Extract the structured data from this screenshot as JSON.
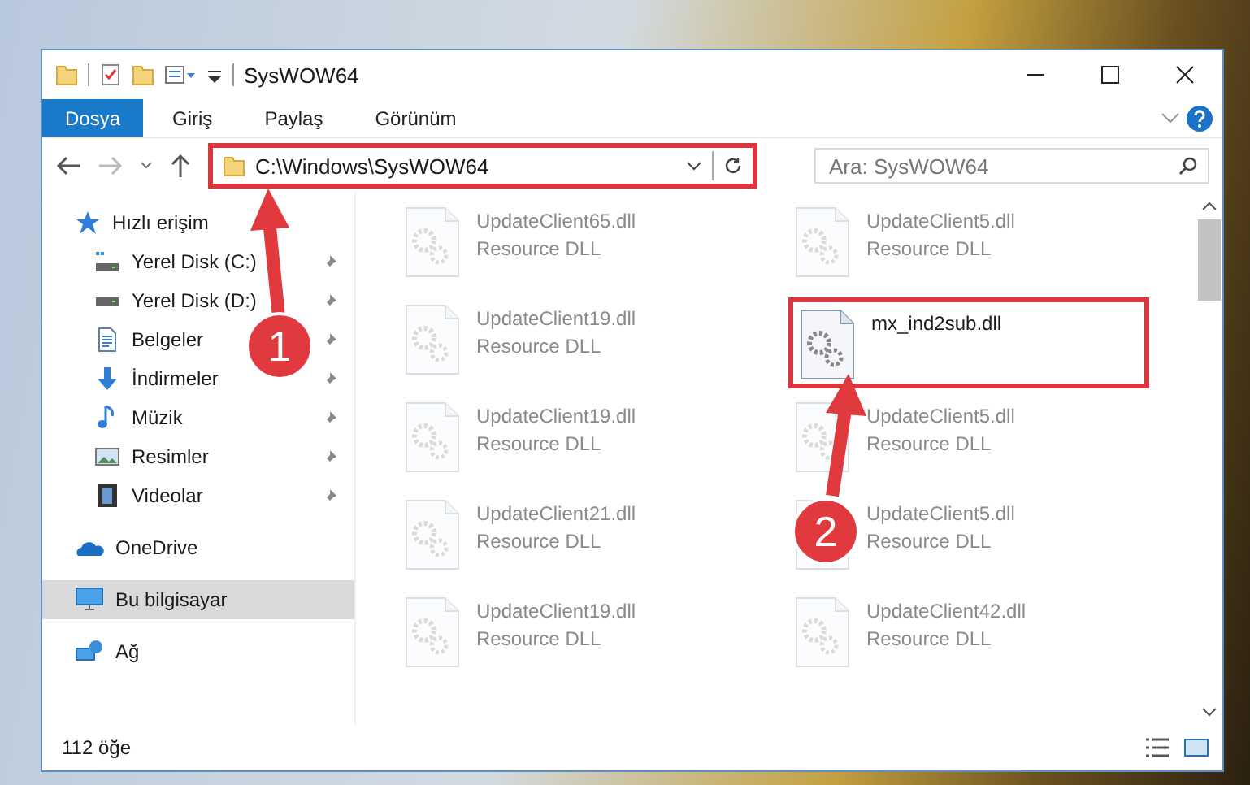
{
  "window": {
    "title": "SysWOW64"
  },
  "ribbon_tabs": [
    {
      "label": "Dosya",
      "selected": true
    },
    {
      "label": "Giriş",
      "selected": false
    },
    {
      "label": "Paylaş",
      "selected": false
    },
    {
      "label": "Görünüm",
      "selected": false
    }
  ],
  "address_bar": {
    "path": "C:\\Windows\\SysWOW64",
    "highlighted": true
  },
  "search": {
    "placeholder": "Ara: SysWOW64"
  },
  "sidebar": {
    "items": [
      {
        "label": "Hızlı erişim",
        "kind": "star",
        "selected": false,
        "children": [
          {
            "label": "Yerel Disk (C:)",
            "kind": "drive-c",
            "pinned": true,
            "selected": false
          },
          {
            "label": "Yerel Disk (D:)",
            "kind": "drive",
            "pinned": true,
            "selected": false
          },
          {
            "label": "Belgeler",
            "kind": "document",
            "pinned": true,
            "selected": false
          },
          {
            "label": "İndirmeler",
            "kind": "download",
            "pinned": true,
            "selected": false
          },
          {
            "label": "Müzik",
            "kind": "music",
            "pinned": true,
            "selected": false
          },
          {
            "label": "Resimler",
            "kind": "picture",
            "pinned": true,
            "selected": false
          },
          {
            "label": "Videolar",
            "kind": "video",
            "pinned": true,
            "selected": false
          }
        ]
      },
      {
        "label": "OneDrive",
        "kind": "cloud",
        "selected": false
      },
      {
        "label": "Bu bilgisayar",
        "kind": "computer",
        "selected": true
      },
      {
        "label": "Ağ",
        "kind": "network",
        "selected": false
      }
    ]
  },
  "files": [
    {
      "name": "UpdateClient65.dll",
      "type": "Resource DLL",
      "faded": true,
      "highlighted": false
    },
    {
      "name": "UpdateClient5.dll",
      "type": "Resource DLL",
      "faded": true,
      "highlighted": false
    },
    {
      "name": "UpdateClient19.dll",
      "type": "Resource DLL",
      "faded": true,
      "highlighted": false
    },
    {
      "name": "mx_ind2sub.dll",
      "faded": false,
      "highlighted": true
    },
    {
      "name": "UpdateClient19.dll",
      "type": "Resource DLL",
      "faded": true,
      "highlighted": false
    },
    {
      "name": "UpdateClient5.dll",
      "type": "Resource DLL",
      "faded": true,
      "highlighted": false
    },
    {
      "name": "UpdateClient21.dll",
      "type": "Resource DLL",
      "faded": true,
      "highlighted": false
    },
    {
      "name": "UpdateClient5.dll",
      "type": "Resource DLL",
      "faded": true,
      "highlighted": false
    },
    {
      "name": "UpdateClient19.dll",
      "type": "Resource DLL",
      "faded": true,
      "highlighted": false
    },
    {
      "name": "UpdateClient42.dll",
      "type": "Resource DLL",
      "faded": true,
      "highlighted": false
    }
  ],
  "annotations": [
    {
      "number": "1"
    },
    {
      "number": "2"
    }
  ],
  "status_bar": {
    "item_count": "112 öğe"
  }
}
